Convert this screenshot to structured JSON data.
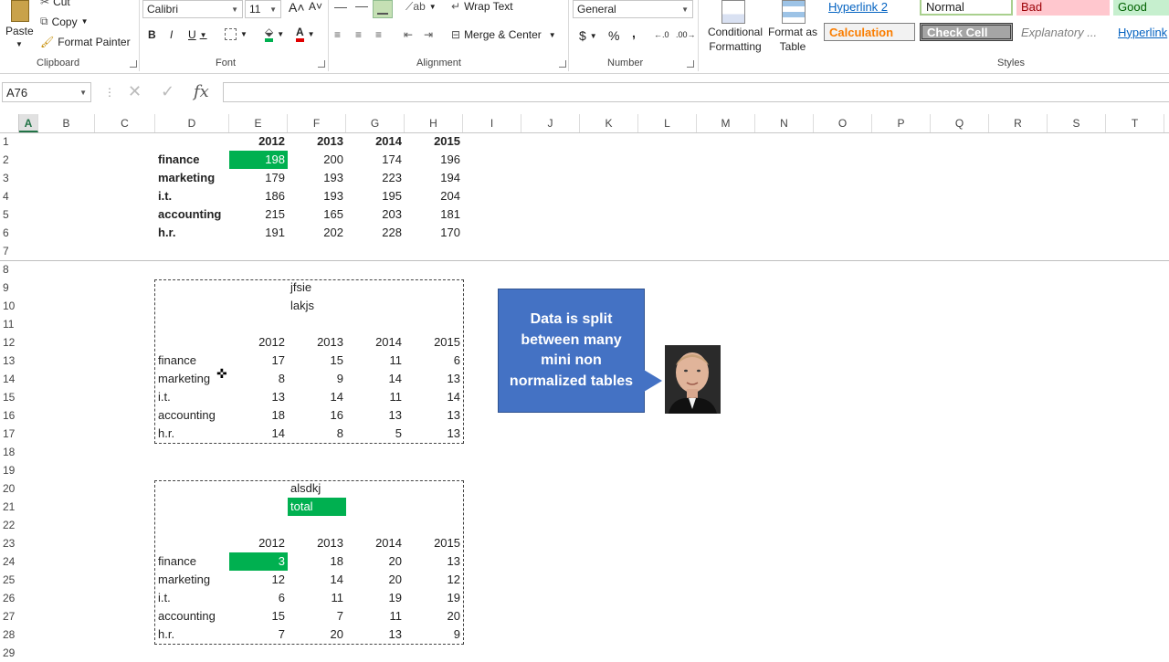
{
  "ribbon": {
    "clipboard": {
      "cut": "Cut",
      "copy": "Copy",
      "paste": "Paste",
      "format_painter": "Format Painter",
      "label": "Clipboard"
    },
    "font": {
      "name": "Calibri",
      "size": "11",
      "bold": "B",
      "italic": "I",
      "underline": "U",
      "label": "Font"
    },
    "alignment": {
      "wrap_text": "Wrap Text",
      "merge_center": "Merge & Center",
      "label": "Alignment"
    },
    "number": {
      "format": "General",
      "currency": "$",
      "percent": "%",
      "comma": ",",
      "label": "Number"
    },
    "styles": {
      "conditional": "Conditional Formatting",
      "format_table": "Format as Table",
      "label": "Styles",
      "cells": [
        "Hyperlink 2",
        "Normal",
        "Bad",
        "Good",
        "Calculation",
        "Check Cell",
        "Explanatory ...",
        "Hyperlink"
      ]
    }
  },
  "formula_bar": {
    "name_box": "A76",
    "fx": "fx",
    "content": ""
  },
  "columns": [
    "A",
    "B",
    "C",
    "D",
    "E",
    "F",
    "G",
    "H",
    "I",
    "J",
    "K",
    "L",
    "M",
    "N",
    "O",
    "P",
    "Q",
    "R",
    "S",
    "T"
  ],
  "rows": [
    "1",
    "2",
    "3",
    "4",
    "5",
    "6",
    "7",
    "8",
    "9",
    "10",
    "11",
    "12",
    "13",
    "14",
    "15",
    "16",
    "17",
    "18",
    "19",
    "20",
    "21",
    "22",
    "23",
    "24",
    "25",
    "26",
    "27",
    "28",
    "29"
  ],
  "table1": {
    "years": [
      "2012",
      "2013",
      "2014",
      "2015"
    ],
    "rows": [
      {
        "label": "finance",
        "values": [
          "198",
          "200",
          "174",
          "196"
        ]
      },
      {
        "label": "marketing",
        "values": [
          "179",
          "193",
          "223",
          "194"
        ]
      },
      {
        "label": "i.t.",
        "values": [
          "186",
          "193",
          "195",
          "204"
        ]
      },
      {
        "label": "accounting",
        "values": [
          "215",
          "165",
          "203",
          "181"
        ]
      },
      {
        "label": "h.r.",
        "values": [
          "191",
          "202",
          "228",
          "170"
        ]
      }
    ]
  },
  "table2": {
    "title1": "jfsie",
    "title2": "lakjs",
    "years": [
      "2012",
      "2013",
      "2014",
      "2015"
    ],
    "rows": [
      {
        "label": "finance",
        "values": [
          "17",
          "15",
          "11",
          "6"
        ]
      },
      {
        "label": "marketing",
        "values": [
          "8",
          "9",
          "14",
          "13"
        ]
      },
      {
        "label": "i.t.",
        "values": [
          "13",
          "14",
          "11",
          "14"
        ]
      },
      {
        "label": "accounting",
        "values": [
          "18",
          "16",
          "13",
          "13"
        ]
      },
      {
        "label": "h.r.",
        "values": [
          "14",
          "8",
          "5",
          "13"
        ]
      }
    ]
  },
  "table3": {
    "title1": "alsdkj",
    "title2": "total",
    "years": [
      "2012",
      "2013",
      "2014",
      "2015"
    ],
    "rows": [
      {
        "label": "finance",
        "values": [
          "3",
          "18",
          "20",
          "13"
        ]
      },
      {
        "label": "marketing",
        "values": [
          "12",
          "14",
          "20",
          "12"
        ]
      },
      {
        "label": "i.t.",
        "values": [
          "6",
          "11",
          "19",
          "19"
        ]
      },
      {
        "label": "accounting",
        "values": [
          "15",
          "7",
          "11",
          "20"
        ]
      },
      {
        "label": "h.r.",
        "values": [
          "7",
          "20",
          "13",
          "9"
        ]
      }
    ]
  },
  "callout": {
    "text": "Data is split between many mini non normalized tables"
  },
  "colors": {
    "accent_green": "#00b050",
    "callout_blue": "#4472c4",
    "excel_green": "#217346"
  }
}
